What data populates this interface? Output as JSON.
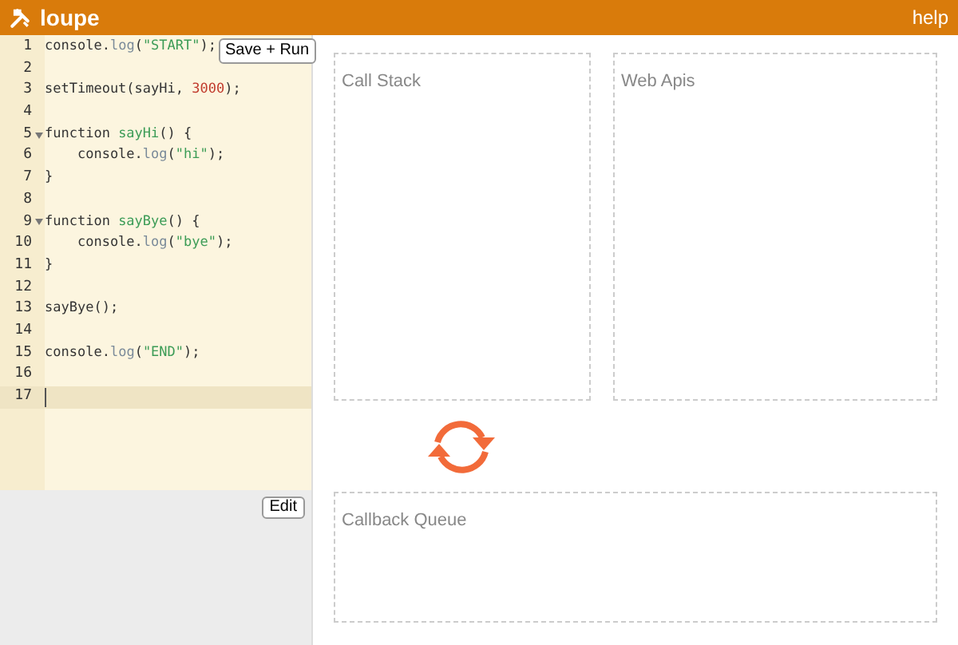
{
  "header": {
    "title": "loupe",
    "help": "help"
  },
  "editor": {
    "run_button": "Save + Run",
    "edit_button": "Edit",
    "lines": [
      {
        "number": "1",
        "foldable": false,
        "active": false,
        "tokens": [
          {
            "kind": "plain",
            "text": "console."
          },
          {
            "kind": "prop",
            "text": "log"
          },
          {
            "kind": "plain",
            "text": "("
          },
          {
            "kind": "string",
            "text": "\"START\""
          },
          {
            "kind": "plain",
            "text": ");"
          }
        ]
      },
      {
        "number": "2",
        "foldable": false,
        "active": false
      },
      {
        "number": "3",
        "foldable": false,
        "active": false,
        "tokens": [
          {
            "kind": "plain",
            "text": "setTimeout(sayHi, "
          },
          {
            "kind": "number",
            "text": "3000"
          },
          {
            "kind": "plain",
            "text": ");"
          }
        ]
      },
      {
        "number": "4",
        "foldable": false,
        "active": false
      },
      {
        "number": "5",
        "foldable": true,
        "active": false,
        "tokens": [
          {
            "kind": "plain",
            "text": "function "
          },
          {
            "kind": "def",
            "text": "sayHi"
          },
          {
            "kind": "plain",
            "text": "() {"
          }
        ]
      },
      {
        "number": "6",
        "foldable": false,
        "active": false,
        "tokens": [
          {
            "kind": "plain",
            "text": "    console."
          },
          {
            "kind": "prop",
            "text": "log"
          },
          {
            "kind": "plain",
            "text": "("
          },
          {
            "kind": "string",
            "text": "\"hi\""
          },
          {
            "kind": "plain",
            "text": ");"
          }
        ]
      },
      {
        "number": "7",
        "foldable": false,
        "active": false,
        "tokens": [
          {
            "kind": "plain",
            "text": "}"
          }
        ]
      },
      {
        "number": "8",
        "foldable": false,
        "active": false
      },
      {
        "number": "9",
        "foldable": true,
        "active": false,
        "tokens": [
          {
            "kind": "plain",
            "text": "function "
          },
          {
            "kind": "def",
            "text": "sayBye"
          },
          {
            "kind": "plain",
            "text": "() {"
          }
        ]
      },
      {
        "number": "10",
        "foldable": false,
        "active": false,
        "tokens": [
          {
            "kind": "plain",
            "text": "    console."
          },
          {
            "kind": "prop",
            "text": "log"
          },
          {
            "kind": "plain",
            "text": "("
          },
          {
            "kind": "string",
            "text": "\"bye\""
          },
          {
            "kind": "plain",
            "text": ");"
          }
        ]
      },
      {
        "number": "11",
        "foldable": false,
        "active": false,
        "tokens": [
          {
            "kind": "plain",
            "text": "}"
          }
        ]
      },
      {
        "number": "12",
        "foldable": false,
        "active": false
      },
      {
        "number": "13",
        "foldable": false,
        "active": false,
        "tokens": [
          {
            "kind": "plain",
            "text": "sayBye();"
          }
        ]
      },
      {
        "number": "14",
        "foldable": false,
        "active": false
      },
      {
        "number": "15",
        "foldable": false,
        "active": false,
        "tokens": [
          {
            "kind": "plain",
            "text": "console."
          },
          {
            "kind": "prop",
            "text": "log"
          },
          {
            "kind": "plain",
            "text": "("
          },
          {
            "kind": "string",
            "text": "\"END\""
          },
          {
            "kind": "plain",
            "text": ");"
          }
        ]
      },
      {
        "number": "16",
        "foldable": false,
        "active": false
      },
      {
        "number": "17",
        "foldable": false,
        "active": true
      }
    ]
  },
  "panels": {
    "call_stack": "Call Stack",
    "web_apis": "Web Apis",
    "callback_queue": "Callback Queue"
  }
}
